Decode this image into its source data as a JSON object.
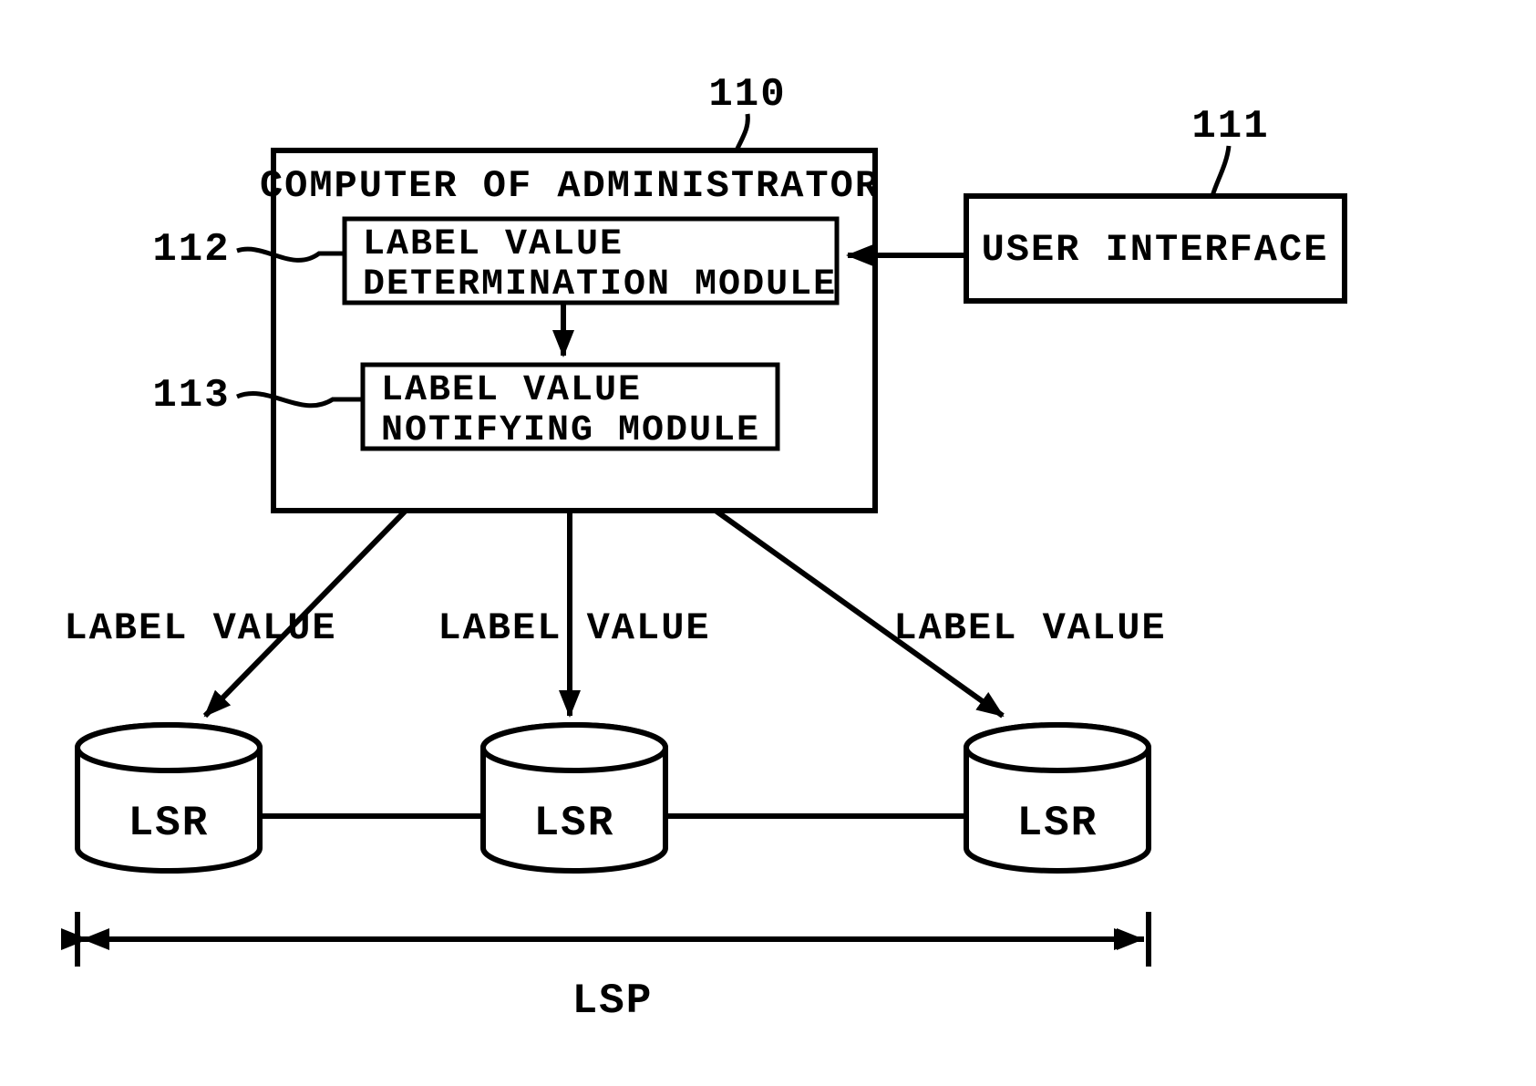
{
  "refs": {
    "computer": "110",
    "ui": "111",
    "det_module": "112",
    "not_module": "113"
  },
  "boxes": {
    "computer_title": "COMPUTER OF ADMINISTRATOR",
    "det_module_line1": "LABEL VALUE",
    "det_module_line2": "DETERMINATION MODULE",
    "not_module_line1": "LABEL VALUE",
    "not_module_line2": "NOTIFYING MODULE",
    "user_interface": "USER INTERFACE"
  },
  "arrows": {
    "label_value": "LABEL VALUE"
  },
  "nodes": {
    "lsr": "LSR"
  },
  "span_label": "LSP"
}
